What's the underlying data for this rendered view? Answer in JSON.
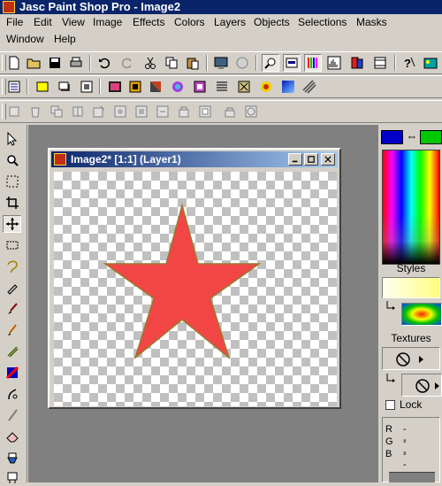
{
  "window": {
    "title": "Jasc Paint Shop Pro - Image2"
  },
  "menu": [
    "File",
    "Edit",
    "View",
    "Image",
    "Effects",
    "Colors",
    "Layers",
    "Objects",
    "Selections",
    "Masks",
    "Window",
    "Help"
  ],
  "toolbar1": {
    "icons": [
      "new-icon",
      "open-icon",
      "save-icon",
      "print-icon",
      "undo-icon",
      "redo-icon",
      "cut-icon",
      "copy-icon",
      "paste-icon",
      "browse-icon",
      "resource-icon",
      "zoom-icon",
      "overview-icon",
      "color-palette-icon",
      "histogram-icon",
      "layer-palette-icon",
      "toolbar-icon",
      "context-help-icon",
      "image-icon"
    ]
  },
  "toolbar2": {
    "icons": [
      "tool-options-icon",
      "selection-effect-icon",
      "drop-shadow-icon",
      "cutout-icon",
      "frame-icon",
      "bevel-icon",
      "buttonize-icon",
      "kaleidoscope-icon",
      "inner-bevel-icon",
      "blinds-icon",
      "effect-browser-icon",
      "sunburst-icon",
      "gradient-icon",
      "texture-icon"
    ]
  },
  "toolbar3": {
    "icons": [
      "layer-new-icon",
      "layer-delete-icon",
      "layer-duplicate-icon",
      "layer-properties-icon",
      "layer-vector-icon",
      "layer-mask-icon",
      "layer-adjust-icon",
      "layer-merge-icon",
      "layer-promote-icon",
      "layer-group-icon",
      "layer-lock-icon"
    ]
  },
  "image_window": {
    "title": "Image2* [1:1] (Layer1)",
    "shape_color": "#f24545",
    "shape_outline": "#9a7a2a"
  },
  "right_panel": {
    "foreground_color": "#0000c8",
    "background_color": "#00c800",
    "styles_label": "Styles",
    "textures_label": "Textures",
    "lock_label": "Lock",
    "rgb": [
      {
        "label": "R",
        "value": "--"
      },
      {
        "label": "G",
        "value": "--"
      },
      {
        "label": "B",
        "value": "--"
      }
    ]
  }
}
